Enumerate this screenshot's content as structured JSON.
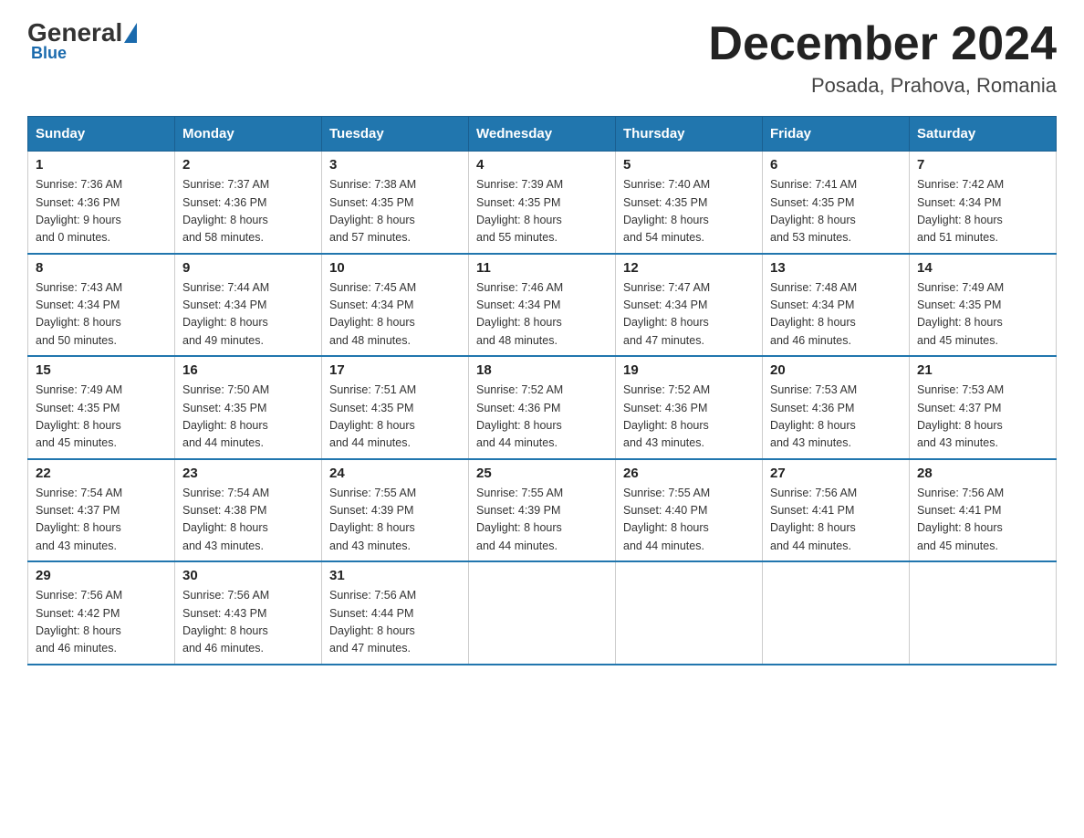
{
  "header": {
    "logo": {
      "general": "General",
      "blue": "Blue"
    },
    "title": "December 2024",
    "location": "Posada, Prahova, Romania"
  },
  "days_of_week": [
    "Sunday",
    "Monday",
    "Tuesday",
    "Wednesday",
    "Thursday",
    "Friday",
    "Saturday"
  ],
  "weeks": [
    [
      {
        "day": "1",
        "sunrise": "7:36 AM",
        "sunset": "4:36 PM",
        "daylight": "9 hours and 0 minutes."
      },
      {
        "day": "2",
        "sunrise": "7:37 AM",
        "sunset": "4:36 PM",
        "daylight": "8 hours and 58 minutes."
      },
      {
        "day": "3",
        "sunrise": "7:38 AM",
        "sunset": "4:35 PM",
        "daylight": "8 hours and 57 minutes."
      },
      {
        "day": "4",
        "sunrise": "7:39 AM",
        "sunset": "4:35 PM",
        "daylight": "8 hours and 55 minutes."
      },
      {
        "day": "5",
        "sunrise": "7:40 AM",
        "sunset": "4:35 PM",
        "daylight": "8 hours and 54 minutes."
      },
      {
        "day": "6",
        "sunrise": "7:41 AM",
        "sunset": "4:35 PM",
        "daylight": "8 hours and 53 minutes."
      },
      {
        "day": "7",
        "sunrise": "7:42 AM",
        "sunset": "4:34 PM",
        "daylight": "8 hours and 51 minutes."
      }
    ],
    [
      {
        "day": "8",
        "sunrise": "7:43 AM",
        "sunset": "4:34 PM",
        "daylight": "8 hours and 50 minutes."
      },
      {
        "day": "9",
        "sunrise": "7:44 AM",
        "sunset": "4:34 PM",
        "daylight": "8 hours and 49 minutes."
      },
      {
        "day": "10",
        "sunrise": "7:45 AM",
        "sunset": "4:34 PM",
        "daylight": "8 hours and 48 minutes."
      },
      {
        "day": "11",
        "sunrise": "7:46 AM",
        "sunset": "4:34 PM",
        "daylight": "8 hours and 48 minutes."
      },
      {
        "day": "12",
        "sunrise": "7:47 AM",
        "sunset": "4:34 PM",
        "daylight": "8 hours and 47 minutes."
      },
      {
        "day": "13",
        "sunrise": "7:48 AM",
        "sunset": "4:34 PM",
        "daylight": "8 hours and 46 minutes."
      },
      {
        "day": "14",
        "sunrise": "7:49 AM",
        "sunset": "4:35 PM",
        "daylight": "8 hours and 45 minutes."
      }
    ],
    [
      {
        "day": "15",
        "sunrise": "7:49 AM",
        "sunset": "4:35 PM",
        "daylight": "8 hours and 45 minutes."
      },
      {
        "day": "16",
        "sunrise": "7:50 AM",
        "sunset": "4:35 PM",
        "daylight": "8 hours and 44 minutes."
      },
      {
        "day": "17",
        "sunrise": "7:51 AM",
        "sunset": "4:35 PM",
        "daylight": "8 hours and 44 minutes."
      },
      {
        "day": "18",
        "sunrise": "7:52 AM",
        "sunset": "4:36 PM",
        "daylight": "8 hours and 44 minutes."
      },
      {
        "day": "19",
        "sunrise": "7:52 AM",
        "sunset": "4:36 PM",
        "daylight": "8 hours and 43 minutes."
      },
      {
        "day": "20",
        "sunrise": "7:53 AM",
        "sunset": "4:36 PM",
        "daylight": "8 hours and 43 minutes."
      },
      {
        "day": "21",
        "sunrise": "7:53 AM",
        "sunset": "4:37 PM",
        "daylight": "8 hours and 43 minutes."
      }
    ],
    [
      {
        "day": "22",
        "sunrise": "7:54 AM",
        "sunset": "4:37 PM",
        "daylight": "8 hours and 43 minutes."
      },
      {
        "day": "23",
        "sunrise": "7:54 AM",
        "sunset": "4:38 PM",
        "daylight": "8 hours and 43 minutes."
      },
      {
        "day": "24",
        "sunrise": "7:55 AM",
        "sunset": "4:39 PM",
        "daylight": "8 hours and 43 minutes."
      },
      {
        "day": "25",
        "sunrise": "7:55 AM",
        "sunset": "4:39 PM",
        "daylight": "8 hours and 44 minutes."
      },
      {
        "day": "26",
        "sunrise": "7:55 AM",
        "sunset": "4:40 PM",
        "daylight": "8 hours and 44 minutes."
      },
      {
        "day": "27",
        "sunrise": "7:56 AM",
        "sunset": "4:41 PM",
        "daylight": "8 hours and 44 minutes."
      },
      {
        "day": "28",
        "sunrise": "7:56 AM",
        "sunset": "4:41 PM",
        "daylight": "8 hours and 45 minutes."
      }
    ],
    [
      {
        "day": "29",
        "sunrise": "7:56 AM",
        "sunset": "4:42 PM",
        "daylight": "8 hours and 46 minutes."
      },
      {
        "day": "30",
        "sunrise": "7:56 AM",
        "sunset": "4:43 PM",
        "daylight": "8 hours and 46 minutes."
      },
      {
        "day": "31",
        "sunrise": "7:56 AM",
        "sunset": "4:44 PM",
        "daylight": "8 hours and 47 minutes."
      },
      null,
      null,
      null,
      null
    ]
  ],
  "labels": {
    "sunrise": "Sunrise:",
    "sunset": "Sunset:",
    "daylight": "Daylight:"
  }
}
